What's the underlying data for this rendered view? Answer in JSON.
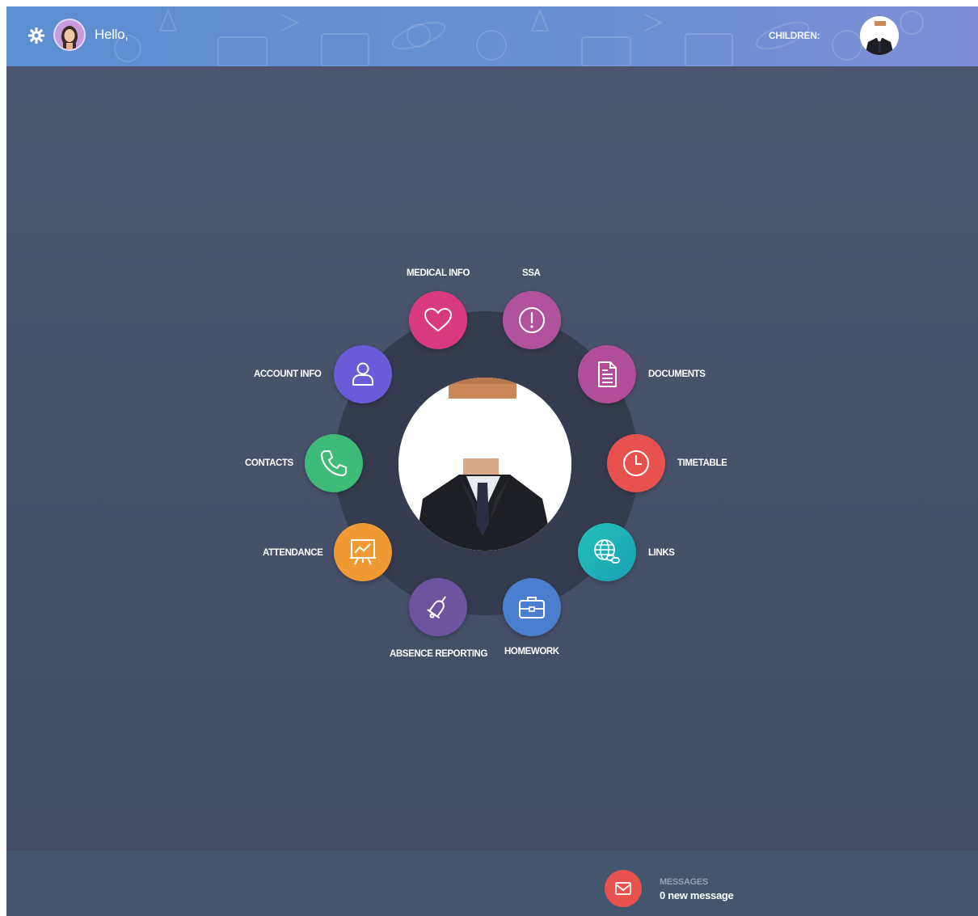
{
  "header": {
    "greeting": "Hello,",
    "children_label": "CHILDREN:",
    "gradient_colors": [
      "#5b8fd0",
      "#7d8ed6"
    ]
  },
  "menu": {
    "items": [
      {
        "label": "MEDICAL INFO",
        "icon": "heart-icon",
        "color": "#d93a7e"
      },
      {
        "label": "SSA",
        "icon": "exclamation-circle-icon",
        "color": "#b0539c"
      },
      {
        "label": "DOCUMENTS",
        "icon": "document-icon",
        "color": "#b24d9a"
      },
      {
        "label": "TIMETABLE",
        "icon": "clock-icon",
        "color": "#e8524e"
      },
      {
        "label": "LINKS",
        "icon": "globe-link-icon",
        "color": "#1bb6b3"
      },
      {
        "label": "HOMEWORK",
        "icon": "briefcase-icon",
        "color": "#4a7fd0"
      },
      {
        "label": "ABSENCE REPORTING",
        "icon": "bell-icon",
        "color": "#6d549f"
      },
      {
        "label": "ATTENDANCE",
        "icon": "presentation-chart-icon",
        "color": "#f09a35"
      },
      {
        "label": "CONTACTS",
        "icon": "phone-icon",
        "color": "#3ebb76"
      },
      {
        "label": "ACCOUNT INFO",
        "icon": "user-icon",
        "color": "#6c5bd8"
      }
    ]
  },
  "footer": {
    "messages_title": "MESSAGES",
    "messages_count": "0 new message",
    "icon": "envelope-icon",
    "color": "#e8524e"
  }
}
